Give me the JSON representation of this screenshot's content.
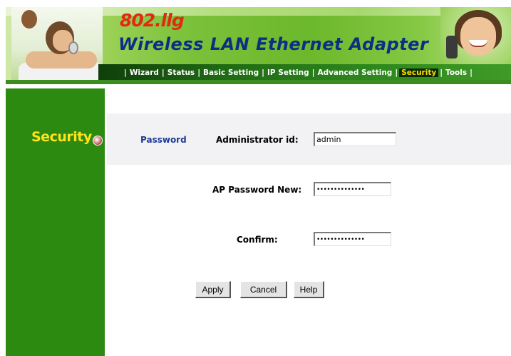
{
  "header": {
    "model": "802.llg",
    "product_title": "Wireless LAN Ethernet Adapter",
    "nav": [
      {
        "label": "Wizard",
        "active": false
      },
      {
        "label": "Status",
        "active": false
      },
      {
        "label": "Basic Setting",
        "active": false
      },
      {
        "label": "IP Setting",
        "active": false
      },
      {
        "label": "Advanced Setting",
        "active": false
      },
      {
        "label": "Security",
        "active": true
      },
      {
        "label": "Tools",
        "active": false
      }
    ]
  },
  "sidebar": {
    "title": "Security",
    "bullet_icon": "radio-bullet-icon"
  },
  "form": {
    "section_label": "Password",
    "admin_id_label": "Administrator id:",
    "admin_id_value": "admin",
    "new_password_label": "AP Password New:",
    "new_password_value": "••••••••••••••",
    "confirm_label": "Confirm:",
    "confirm_value": "••••••••••••••"
  },
  "buttons": {
    "apply": "Apply",
    "cancel": "Cancel",
    "help": "Help"
  },
  "colors": {
    "brand_red": "#e02a12",
    "brand_blue": "#0c2f83",
    "sidebar_green": "#2b8a0f",
    "sidebar_title_yellow": "#ffe21a",
    "active_nav_yellow": "#ffde00"
  }
}
